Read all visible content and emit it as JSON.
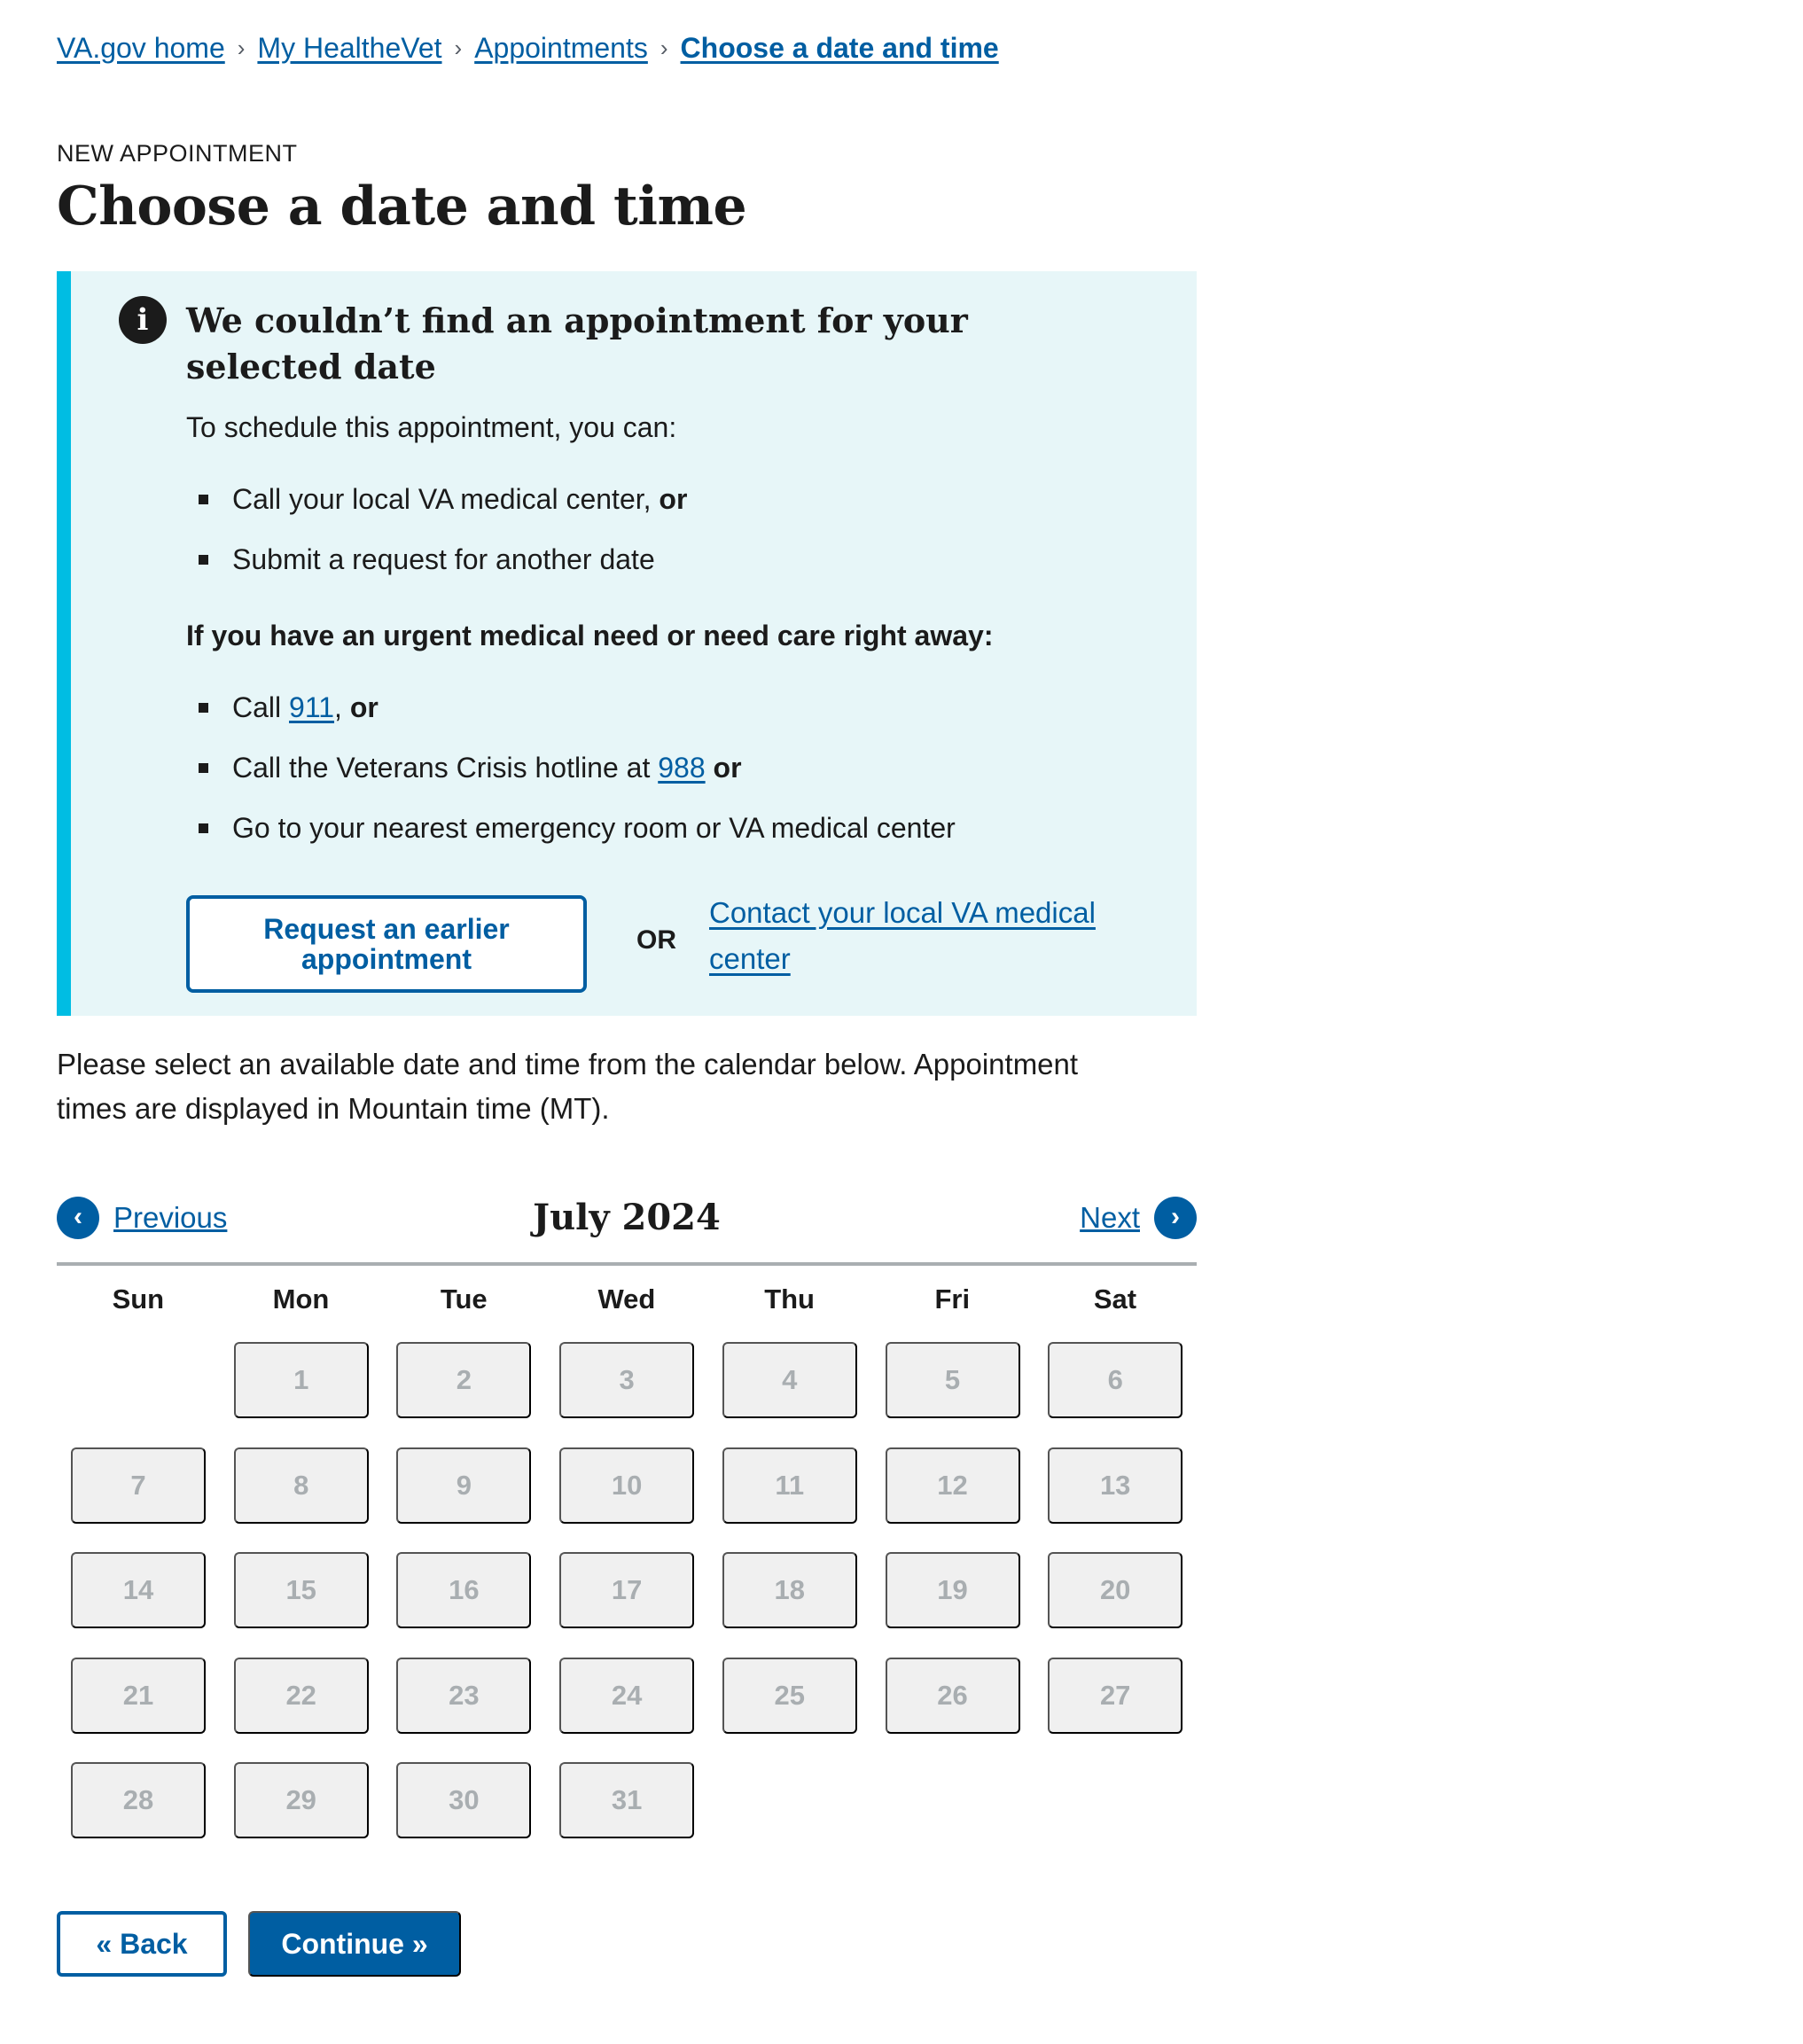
{
  "breadcrumb": {
    "items": [
      "VA.gov home",
      "My HealtheVet",
      "Appointments",
      "Choose a date and time"
    ],
    "separator": "›"
  },
  "eyebrow": "NEW APPOINTMENT",
  "page_title": "Choose a date and time",
  "alert": {
    "icon": "info-icon",
    "icon_glyph": "i",
    "title": "We couldn’t find an appointment for your selected date",
    "intro": "To schedule this appointment, you can:",
    "options": [
      {
        "text": "Call your local VA medical center, ",
        "bold": "or"
      },
      {
        "text": "Submit a request for another date"
      }
    ],
    "urgent_heading": "If you have an urgent medical need or need care right away:",
    "urgent_items": [
      {
        "pre": "Call ",
        "link": "911",
        "post": ", ",
        "bold": "or"
      },
      {
        "pre": "Call the Veterans Crisis hotline at ",
        "link": "988",
        "post": " ",
        "bold": "or"
      },
      {
        "pre": "Go to your nearest emergency room or VA medical center"
      }
    ],
    "request_button": "Request an earlier appointment",
    "or_label": "OR",
    "contact_link": "Contact your local VA medical center"
  },
  "instructions": "Please select an available date and time from the calendar below. Appointment times are displayed in Mountain time (MT).",
  "calendar": {
    "month_label": "July 2024",
    "prev_label": "Previous",
    "next_label": "Next",
    "weekdays": [
      "Sun",
      "Mon",
      "Tue",
      "Wed",
      "Thu",
      "Fri",
      "Sat"
    ],
    "days": [
      "1",
      "2",
      "3",
      "4",
      "5",
      "6",
      "7",
      "8",
      "9",
      "10",
      "11",
      "12",
      "13",
      "14",
      "15",
      "16",
      "17",
      "18",
      "19",
      "20",
      "21",
      "22",
      "23",
      "24",
      "25",
      "26",
      "27",
      "28",
      "29",
      "30",
      "31"
    ]
  },
  "footer": {
    "back_label": "«  Back",
    "continue_label": "Continue »"
  },
  "colors": {
    "link": "#005ea2",
    "alert_bg": "#e7f6f8",
    "alert_border": "#00bde3",
    "disabled_day_bg": "#f0f0f0",
    "disabled_day_text": "#a9aeb1"
  }
}
